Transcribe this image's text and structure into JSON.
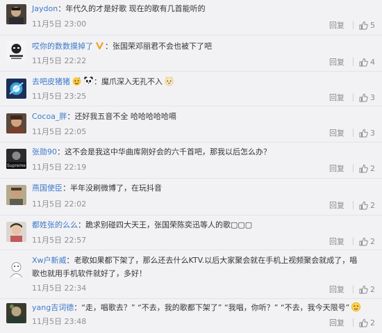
{
  "actions": {
    "reply_label": "回复",
    "like_icon": "thumbs-up-icon"
  },
  "comments": [
    {
      "user": "Jaydon",
      "sep": "：",
      "text": "年代久的才是好歌 现在的歌有几首能听的",
      "time": "11月5日 23:00",
      "likes": "5"
    },
    {
      "user": "哎你的数数摸掉了",
      "sep": "：",
      "text": "张国荣邓丽君不会也被下了吧",
      "time": "11月5日 22:22",
      "likes": "4",
      "badge_icon": "vip-v-icon"
    },
    {
      "user": "去吧皮猪猪",
      "sep": "：",
      "text": "魔爪深入无孔不入",
      "time": "11月5日 23:25",
      "likes": "3",
      "pre_emojis": [
        "sweat-emoji-icon",
        "panda-emoji-icon"
      ],
      "post_emojis": [
        "cat-emoji-icon"
      ]
    },
    {
      "user": "Cocoa_胖",
      "sep": "：",
      "text": "还好我五音不全 哈哈哈哈哈嗝",
      "time": "11月5日 22:05",
      "likes": "3"
    },
    {
      "user": "张勋90",
      "sep": "：",
      "text": "这不会是我这中华曲库刚好会的六千首吧，那我以后怎么办？",
      "time": "11月5日 22:19",
      "likes": "2"
    },
    {
      "user": "燕国使臣",
      "sep": "：",
      "text": "半年没刷微博了，在玩抖音",
      "time": "11月5日 22:02",
      "likes": "2"
    },
    {
      "user": "都姓张的么么",
      "sep": "：",
      "text": "跪求别碰四大天王，张国荣陈奕迅等人的歌▢▢▢",
      "time": "11月5日 22:57",
      "likes": "2"
    },
    {
      "user": "Xw户新威",
      "sep": "：",
      "text": "老歌如果都下架了，那么还去什么KTV.以后大家聚会就在手机上视频聚会就成了，唱",
      "text2": "歌也就用手机软件就好了，多好！",
      "time": "11月5日 22:34",
      "likes": "2"
    },
    {
      "user": "yang吉词德",
      "sep": "：",
      "text": "“走，唱歌去？” “不去，我的歌都下架了” “我唱，你听？” “不去，我今天限号”",
      "time": "11月5日 23:48",
      "likes": "2",
      "post_emojis": [
        "wink-emoji-icon"
      ]
    }
  ]
}
